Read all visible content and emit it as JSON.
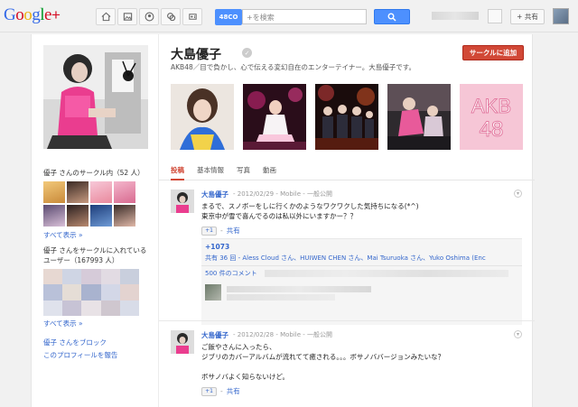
{
  "header": {
    "logo": {
      "g1": "G",
      "g2": "o",
      "g3": "o",
      "g4": "g",
      "g5": "l",
      "g6": "e",
      "plus": "+"
    },
    "notification_count": "48CO",
    "search": {
      "value": "+を検索"
    },
    "share_label": "+ 共有",
    "nav_icons": [
      "home-icon",
      "photos-icon",
      "profile-icon",
      "circles-icon",
      "games-icon"
    ]
  },
  "profile": {
    "name": "大島優子",
    "tagline": "AKB48／目で負かし、心で伝える変幻自在のエンターテイナー。大島優子です。",
    "add_to_circles_label": "サークルに追加",
    "tabs": [
      {
        "label": "投稿",
        "active": true
      },
      {
        "label": "基本情報",
        "active": false
      },
      {
        "label": "写真",
        "active": false
      },
      {
        "label": "動画",
        "active": false
      }
    ]
  },
  "sidebar": {
    "in_circles_title": "優子 さんのサークル内（52 人）",
    "show_all_1": "すべて表示 »",
    "has_in_circles_title_1": "優子 さんをサークルに入れている",
    "has_in_circles_title_2": "ユーザー（167993 人）",
    "show_all_2": "すべて表示 »",
    "block_link": "優子 さんをブロック",
    "report_link": "このプロフィールを報告"
  },
  "posts": [
    {
      "author": "大島優子",
      "meta": "- 2012/02/29 - Mobile - 一般公開",
      "lines": [
        "まるで、スノボーをしに行くかのようなワクワクした気持ちになる(*^)",
        "東京中が雪で喜んでるのは私以外にいますかー？？"
      ],
      "plusone_label": "+1",
      "share_label": "共有",
      "plus_count": "+1073",
      "share_text": "共有 36 回 - Aless Cloud さん、HUIWEN CHEN さん、Mai Tsuruoka さん、Yuko Oshima (Enc",
      "comments_label": "500 件のコメント"
    },
    {
      "author": "大島優子",
      "meta": "- 2012/02/28 - Mobile - 一般公開",
      "lines": [
        "ご飯やさんに入ったら、",
        "ジブリのカバーアルバムが流れてて癒される。。。ボサノババージョンみたいな？",
        "",
        "ボサノバよく知らないけど。"
      ],
      "plusone_label": "+1",
      "share_label": "共有"
    }
  ]
}
